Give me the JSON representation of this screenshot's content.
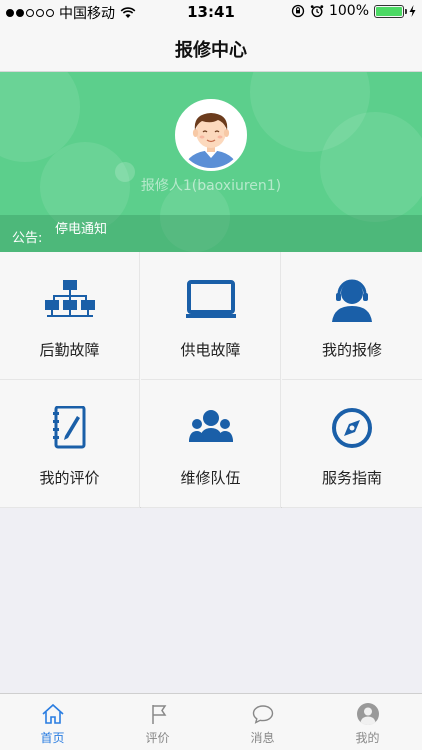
{
  "status_bar": {
    "carrier": "中国移动",
    "time": "13:41",
    "battery": "100%",
    "battery_level": 1.0
  },
  "navbar": {
    "title": "报修中心"
  },
  "profile": {
    "username": "报修人1(baoxiuren1)"
  },
  "notice": {
    "label": "公告:",
    "text": "停电通知"
  },
  "menu": [
    {
      "label": "后勤故障",
      "icon": "network-icon"
    },
    {
      "label": "供电故障",
      "icon": "monitor-icon"
    },
    {
      "label": "我的报修",
      "icon": "support-agent-icon"
    },
    {
      "label": "我的评价",
      "icon": "notebook-icon"
    },
    {
      "label": "维修队伍",
      "icon": "team-icon"
    },
    {
      "label": "服务指南",
      "icon": "compass-icon"
    }
  ],
  "tabs": [
    {
      "label": "首页",
      "icon": "home-icon",
      "active": true
    },
    {
      "label": "评价",
      "icon": "flag-icon",
      "active": false
    },
    {
      "label": "消息",
      "icon": "chat-bubble-icon",
      "active": false
    },
    {
      "label": "我的",
      "icon": "user-icon",
      "active": false
    }
  ],
  "colors": {
    "accent": "#1a5fa8",
    "hero_green": "#5ccf8c",
    "tab_active": "#2a7de1"
  }
}
